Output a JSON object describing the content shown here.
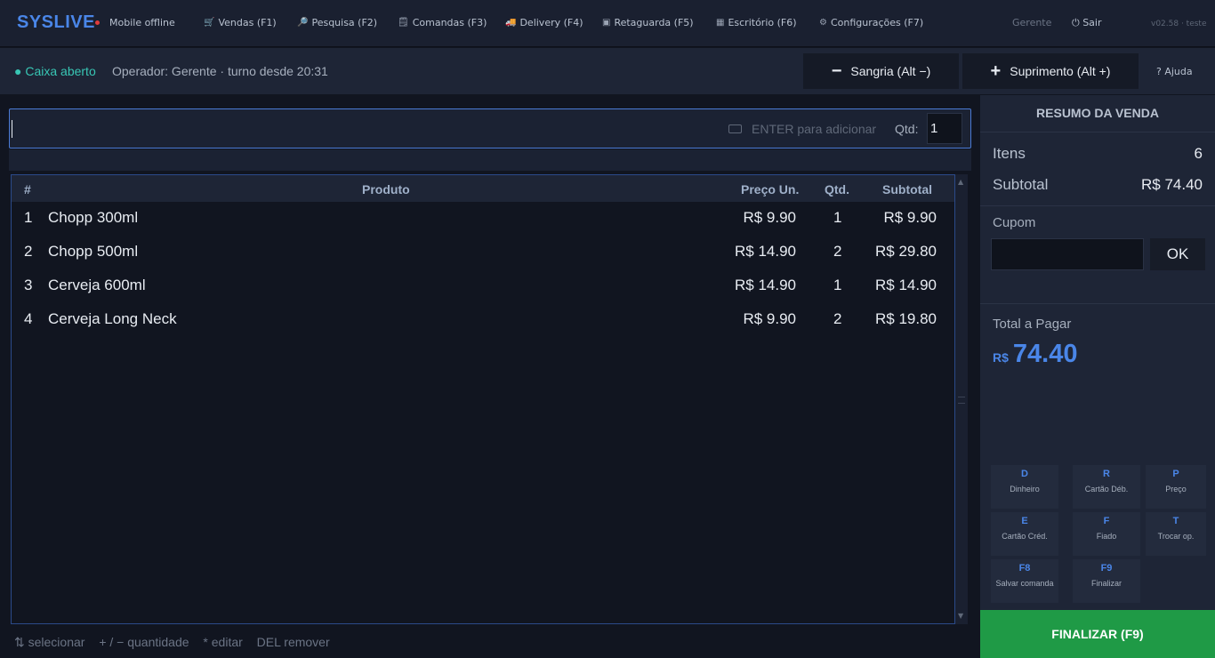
{
  "topbar": {
    "brand": "SYSLIVE",
    "mobile_status": "Mobile offline",
    "nav": [
      {
        "label": "Vendas (F1)",
        "icon": "cart-icon",
        "glyph": "🛒"
      },
      {
        "label": "Pesquisa (F2)",
        "icon": "search-icon",
        "glyph": "🔎"
      },
      {
        "label": "Comandas (F3)",
        "icon": "receipt-icon",
        "glyph": "🗒"
      },
      {
        "label": "Delivery (F4)",
        "icon": "truck-icon",
        "glyph": "🚚"
      },
      {
        "label": "Retaguarda (F5)",
        "icon": "box-icon",
        "glyph": "▣"
      },
      {
        "label": "Escritório (F6)",
        "icon": "building-icon",
        "glyph": "▦"
      },
      {
        "label": "Configurações (F7)",
        "icon": "gear-icon",
        "glyph": "⚙"
      }
    ],
    "user": "Gerente",
    "logout": "⏻ Sair",
    "version": "v02.58 · teste"
  },
  "subbar": {
    "caixa_status": "● Caixa aberto",
    "operator": "Operador: Gerente · turno desde 20:31",
    "sangria": {
      "symbol": "−",
      "label": "Sangria (Alt −)"
    },
    "suprimento": {
      "symbol": "+",
      "label": "Suprimento (Alt +)"
    },
    "help": "? Ajuda"
  },
  "scan": {
    "value": "",
    "hint": "ENTER para adicionar",
    "qty_label": "Qtd:",
    "qty_value": "1"
  },
  "table": {
    "columns": [
      "#",
      "Produto",
      "Preço Un.",
      "Qtd.",
      "Subtotal"
    ],
    "rows": [
      {
        "n": "1",
        "product": "Chopp 300ml",
        "price": "R$ 9.90",
        "qty": "1",
        "subtotal": "R$ 9.90"
      },
      {
        "n": "2",
        "product": "Chopp 500ml",
        "price": "R$ 14.90",
        "qty": "2",
        "subtotal": "R$ 29.80"
      },
      {
        "n": "3",
        "product": "Cerveja 600ml",
        "price": "R$ 14.90",
        "qty": "1",
        "subtotal": "R$ 14.90"
      },
      {
        "n": "4",
        "product": "Cerveja Long Neck",
        "price": "R$ 9.90",
        "qty": "2",
        "subtotal": "R$ 19.80"
      }
    ]
  },
  "hints": [
    "⇅ selecionar",
    "+ / −  quantidade",
    "*  editar",
    "DEL remover"
  ],
  "summary": {
    "title": "RESUMO DA VENDA",
    "items_label": "Itens",
    "items_value": "6",
    "subtotal_label": "Subtotal",
    "subtotal_value": "R$ 74.40",
    "coupon_label": "Cupom",
    "coupon_value": "",
    "ok_label": "OK",
    "total_label": "Total a Pagar",
    "total_currency": "R$",
    "total_value": "74.40"
  },
  "payments": [
    {
      "key": "D",
      "label": "Dinheiro"
    },
    {
      "key": "R",
      "label": "Cartão Déb."
    },
    {
      "key": "P",
      "label": "Preço"
    },
    {
      "key": "E",
      "label": "Cartão Créd."
    },
    {
      "key": "F",
      "label": "Fiado"
    },
    {
      "key": "T",
      "label": "Trocar op."
    },
    {
      "key": "F8",
      "label": "Salvar comanda"
    },
    {
      "key": "F9",
      "label": "Finalizar"
    }
  ],
  "finalize_label": "FINALIZAR (F9)",
  "colors": {
    "accent": "#4a86e8",
    "success": "#1f9a46",
    "status_open": "#38c6b4",
    "status_offline": "#e03c3c"
  }
}
